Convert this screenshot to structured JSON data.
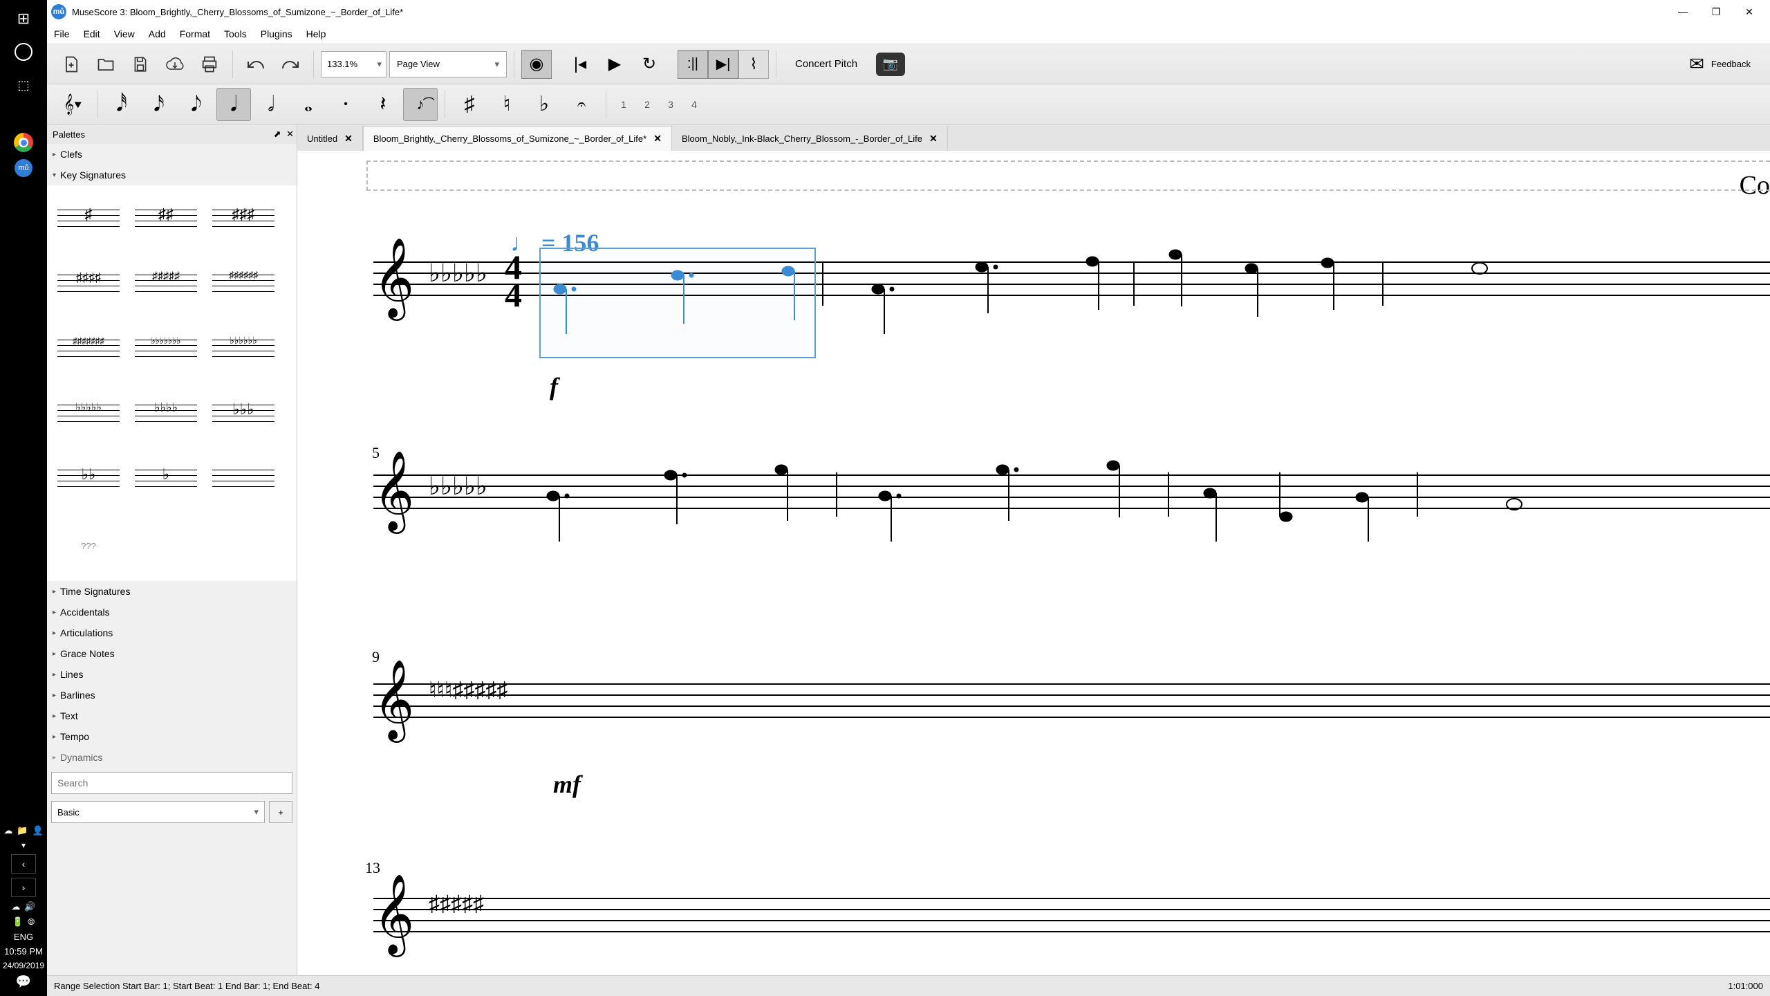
{
  "window": {
    "title": "MuseScore 3: Bloom_Brightly,_Cherry_Blossoms_of_Sumizone_~_Border_of_Life*"
  },
  "menu": {
    "file": "File",
    "edit": "Edit",
    "view": "View",
    "add": "Add",
    "format": "Format",
    "tools": "Tools",
    "plugins": "Plugins",
    "help": "Help"
  },
  "toolbar": {
    "zoom": "133.1%",
    "view_mode": "Page View",
    "concert_pitch": "Concert Pitch",
    "feedback": "Feedback"
  },
  "note_input": {
    "voices": [
      "1",
      "2",
      "3",
      "4"
    ]
  },
  "palettes": {
    "title": "Palettes",
    "clefs": "Clefs",
    "key_signatures": "Key Signatures",
    "unknown": "???",
    "time_signatures": "Time Signatures",
    "accidentals": "Accidentals",
    "articulations": "Articulations",
    "grace_notes": "Grace Notes",
    "lines": "Lines",
    "barlines": "Barlines",
    "text": "Text",
    "tempo": "Tempo",
    "dynamics": "Dynamics",
    "search_placeholder": "Search",
    "workspace": "Basic",
    "add": "+"
  },
  "tabs": {
    "t1": "Untitled",
    "t2": "Bloom_Brightly,_Cherry_Blossoms_of_Sumizone_~_Border_of_Life*",
    "t3": "Bloom_Nobly,_Ink-Black_Cherry_Blossom_-_Border_of_Life"
  },
  "score": {
    "tempo": "♩ = 156",
    "dynamic1": "f",
    "dynamic2": "mf",
    "measure5": "5",
    "measure9": "9",
    "measure13": "13",
    "corner": "Co"
  },
  "status": {
    "text": "Range Selection Start Bar: 1; Start Beat: 1 End Bar: 1; End Beat: 4",
    "time": "1:01:000"
  },
  "system": {
    "lang": "ENG",
    "clock": "10:59 PM",
    "date": "24/09/2019"
  }
}
